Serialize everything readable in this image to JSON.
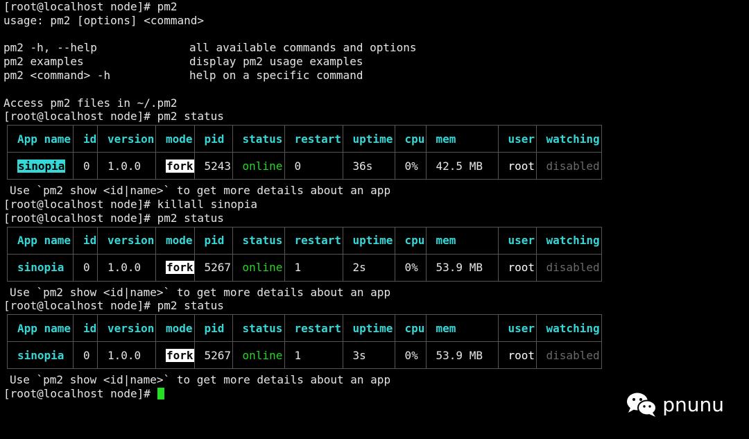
{
  "session": {
    "prompt": "[root@localhost node]# ",
    "lines_top": {
      "cmd1": "pm2",
      "usage": "usage: pm2 [options] <command>",
      "help": [
        {
          "cmd": "pm2 -h, --help",
          "desc": "all available commands and options"
        },
        {
          "cmd": "pm2 examples",
          "desc": "display pm2 usage examples"
        },
        {
          "cmd": "pm2 <command> -h",
          "desc": "help on a specific command"
        }
      ],
      "access": "Access pm2 files in ~/.pm2",
      "cmd2": "pm2 status"
    },
    "table_headers": [
      "App name",
      "id",
      "version",
      "mode",
      "pid",
      "status",
      "restart",
      "uptime",
      "cpu",
      "mem",
      "user",
      "watching"
    ],
    "tables": [
      {
        "app_name": "sinopia",
        "id": "0",
        "version": "1.0.0",
        "mode": "fork",
        "pid": "5243",
        "status": "online",
        "restart": "0",
        "uptime": "36s",
        "cpu": "0%",
        "mem": "42.5 MB",
        "user": "root",
        "watching": "disabled"
      },
      {
        "app_name": "sinopia",
        "id": "0",
        "version": "1.0.0",
        "mode": "fork",
        "pid": "5267",
        "status": "online",
        "restart": "1",
        "uptime": "2s",
        "cpu": "0%",
        "mem": "53.9 MB",
        "user": "root",
        "watching": "disabled"
      },
      {
        "app_name": "sinopia",
        "id": "0",
        "version": "1.0.0",
        "mode": "fork",
        "pid": "5267",
        "status": "online",
        "restart": "1",
        "uptime": "3s",
        "cpu": "0%",
        "mem": "53.9 MB",
        "user": "root",
        "watching": "disabled"
      }
    ],
    "show_hint": "Use `pm2 show <id|name>` to get more details about an app",
    "cmd3": "killall sinopia",
    "cmd4": "pm2 status",
    "cmd5": "pm2 status"
  },
  "watermark": {
    "text": "pnunu",
    "icon": "wechat-icon"
  },
  "colors": {
    "background": "#000000",
    "cyan": "#36d7d7",
    "green": "#27d627",
    "cursor": "#22e022",
    "disabled": "#6a6a6a"
  }
}
